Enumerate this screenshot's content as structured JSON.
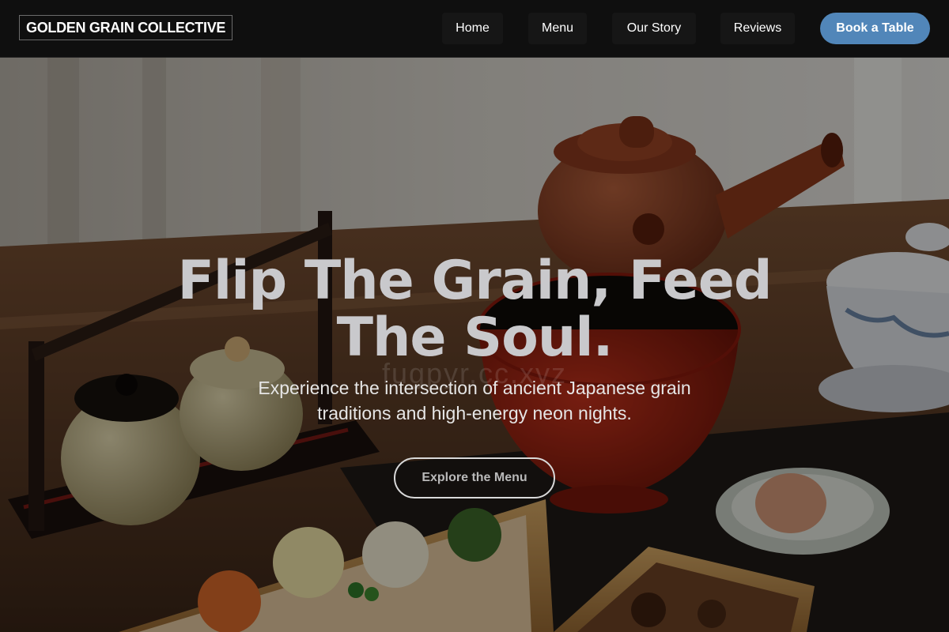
{
  "brand": {
    "name": "GOLDEN GRAIN COLLECTIVE"
  },
  "nav": {
    "items": [
      {
        "label": "Home"
      },
      {
        "label": "Menu"
      },
      {
        "label": "Our Story"
      },
      {
        "label": "Reviews"
      }
    ],
    "cta_label": "Book a Table"
  },
  "hero": {
    "title": "Flip The Grain, Feed The Soul.",
    "subtitle": "Experience the intersection of ancient Japanese grain traditions and high-energy neon nights.",
    "cta_label": "Explore the Menu",
    "watermark": "fugpyr.cc.xyz",
    "image_description": "Japanese tea set with clay kyusu teapot, lacquered bowl, ceramic jars and bento boxes on a wooden table"
  },
  "colors": {
    "header_bg": "#0f0f0f",
    "accent": "#5186b9",
    "text": "#ffffff"
  }
}
